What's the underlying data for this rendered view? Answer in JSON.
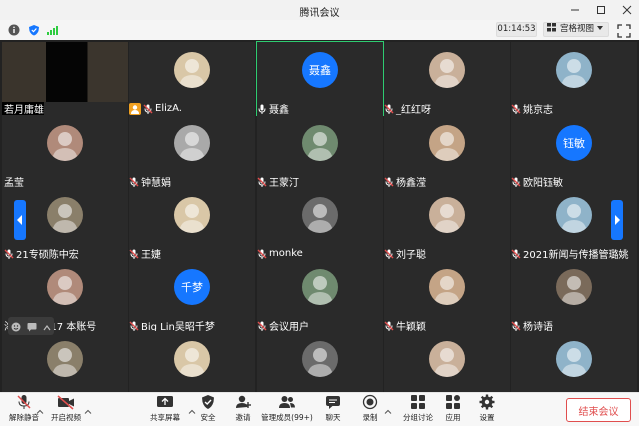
{
  "window": {
    "title": "腾讯会议"
  },
  "infobar": {
    "timer": "01:14:53",
    "view_label": "宫格视图"
  },
  "participants": [
    {
      "name": "若月庸雄",
      "kind": "camera"
    },
    {
      "name": "ElizA.",
      "kind": "photo"
    },
    {
      "name": "聂鑫",
      "kind": "initial",
      "initial": "聂鑫",
      "selected": true
    },
    {
      "name": "_红红呀",
      "kind": "photo"
    },
    {
      "name": "姚京志",
      "kind": "photo"
    },
    {
      "name": "孟莹",
      "kind": "photo"
    },
    {
      "name": "钟慧娟",
      "kind": "photo"
    },
    {
      "name": "王蒙汀",
      "kind": "photo"
    },
    {
      "name": "杨鑫滢",
      "kind": "photo"
    },
    {
      "name": "欧阳钰敏",
      "kind": "initial",
      "initial": "钰敏"
    },
    {
      "name": "21专硕陈中宏",
      "kind": "photo"
    },
    {
      "name": "王婕",
      "kind": "photo"
    },
    {
      "name": "monke",
      "kind": "photo"
    },
    {
      "name": "刘子聪",
      "kind": "photo"
    },
    {
      "name": "2021新闻与传播管璐姚",
      "kind": "photo"
    },
    {
      "name": "海豹十六317 本账号",
      "kind": "photo"
    },
    {
      "name": "Big Lin吴昭千梦",
      "kind": "initial",
      "initial": "千梦"
    },
    {
      "name": "会议用户",
      "kind": "photo"
    },
    {
      "name": "牛颖颖",
      "kind": "photo"
    },
    {
      "name": "杨诗语",
      "kind": "photo"
    },
    {
      "name": "",
      "kind": "photo"
    },
    {
      "name": "",
      "kind": "photo"
    },
    {
      "name": "",
      "kind": "photo"
    },
    {
      "name": "",
      "kind": "photo"
    },
    {
      "name": "",
      "kind": "photo"
    }
  ],
  "toolbar": {
    "mute": "解除静音",
    "video": "开启视频",
    "share": "共享屏幕",
    "security": "安全",
    "invite": "邀请",
    "manage": "管理成员(99+)",
    "chat": "聊天",
    "record": "录制",
    "breakout": "分组讨论",
    "apps": "应用",
    "settings": "设置",
    "end": "结束会议"
  },
  "colors": {
    "accent": "#1677ff",
    "danger": "#e04e4e",
    "grid_bg": "#222222"
  }
}
